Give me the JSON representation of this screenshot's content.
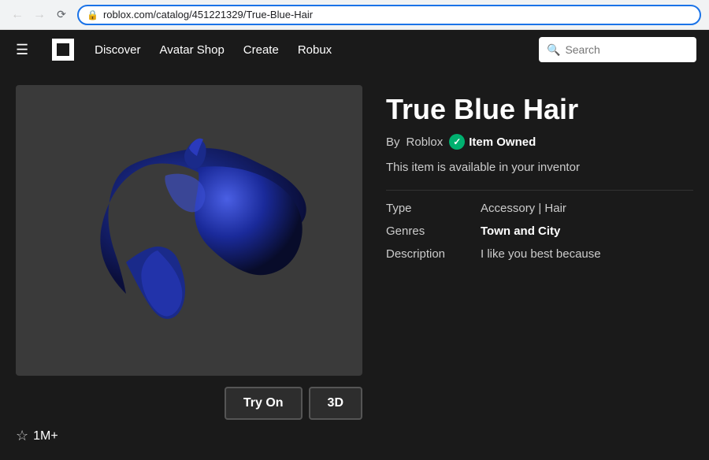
{
  "browser": {
    "back_disabled": true,
    "forward_disabled": true,
    "url": "roblox.com/catalog/451221329/True-Blue-Hair",
    "lock_icon": "🔒"
  },
  "navbar": {
    "hamburger_icon": "☰",
    "logo_alt": "Roblox logo",
    "links": [
      {
        "label": "Discover",
        "id": "discover"
      },
      {
        "label": "Avatar Shop",
        "id": "avatar-shop"
      },
      {
        "label": "Create",
        "id": "create"
      },
      {
        "label": "Robux",
        "id": "robux"
      }
    ],
    "search_placeholder": "Search"
  },
  "item": {
    "title": "True Blue Hair",
    "creator_prefix": "By",
    "creator_name": "Roblox",
    "owned_label": "Item Owned",
    "availability_text": "This item is available in your inventor",
    "meta": [
      {
        "label": "Type",
        "value": "Accessory | Hair",
        "bold": false
      },
      {
        "label": "Genres",
        "value": "Town and City",
        "bold": true
      },
      {
        "label": "Description",
        "value": "I like you best because",
        "bold": false
      }
    ],
    "buttons": [
      {
        "label": "Try On",
        "id": "try-on"
      },
      {
        "label": "3D",
        "id": "3d"
      }
    ],
    "stats": {
      "favorites": "1M+",
      "star_icon": "☆"
    }
  }
}
